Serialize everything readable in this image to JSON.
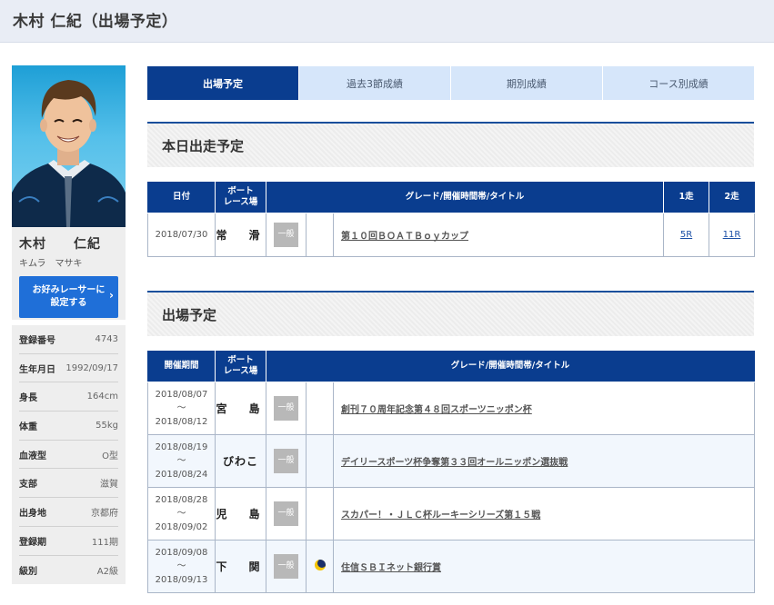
{
  "page": {
    "title": "木村 仁紀（出場予定）"
  },
  "profile": {
    "name_kanji": "木村　　仁紀",
    "name_kana": "キムラ　マサキ",
    "favorite_button": {
      "line1": "お好みレーサーに",
      "line2": "設定する",
      "chevron": "›"
    },
    "details": [
      {
        "label": "登録番号",
        "value": "4743"
      },
      {
        "label": "生年月日",
        "value": "1992/09/17"
      },
      {
        "label": "身長",
        "value": "164cm"
      },
      {
        "label": "体重",
        "value": "55kg"
      },
      {
        "label": "血液型",
        "value": "O型"
      },
      {
        "label": "支部",
        "value": "滋賀"
      },
      {
        "label": "出身地",
        "value": "京都府"
      },
      {
        "label": "登録期",
        "value": "111期"
      },
      {
        "label": "級別",
        "value": "A2級"
      }
    ]
  },
  "tabs": [
    {
      "label": "出場予定",
      "active": true
    },
    {
      "label": "過去3節成績",
      "active": false
    },
    {
      "label": "期別成績",
      "active": false
    },
    {
      "label": "コース別成績",
      "active": false
    }
  ],
  "today": {
    "heading": "本日出走予定",
    "headers": {
      "date": "日付",
      "venue_line1": "ボート",
      "venue_line2": "レース場",
      "grade": "グレード/開催時間帯/タイトル",
      "race1": "1走",
      "race2": "2走"
    },
    "rows": [
      {
        "date": "2018/07/30",
        "venue": "常　滑",
        "grade": "一般",
        "title": "第１０回ＢＯＡＴＢｏｙカップ",
        "race1": "5R",
        "race2": "11R"
      }
    ]
  },
  "schedule": {
    "heading": "出場予定",
    "headers": {
      "period": "開催期間",
      "venue_line1": "ボート",
      "venue_line2": "レース場",
      "grade": "グレード/開催時間帯/タイトル"
    },
    "rows": [
      {
        "start": "2018/08/07",
        "sep": "～",
        "end": "2018/08/12",
        "venue": "宮　島",
        "grade": "一般",
        "time_icon": "",
        "title": "創刊７０周年記念第４８回スポーツニッポン杯"
      },
      {
        "start": "2018/08/19",
        "sep": "～",
        "end": "2018/08/24",
        "venue": "びわこ",
        "grade": "一般",
        "time_icon": "",
        "title": "デイリースポーツ杯争奪第３３回オールニッポン選抜戦"
      },
      {
        "start": "2018/08/28",
        "sep": "～",
        "end": "2018/09/02",
        "venue": "児　島",
        "grade": "一般",
        "time_icon": "",
        "title": "スカパー！・ＪＬＣ杯ルーキーシリーズ第１５戦"
      },
      {
        "start": "2018/09/08",
        "sep": "～",
        "end": "2018/09/13",
        "venue": "下　関",
        "grade": "一般",
        "time_icon": "night-moon-icon",
        "title": "住信ＳＢＩネット銀行賞"
      }
    ]
  }
}
